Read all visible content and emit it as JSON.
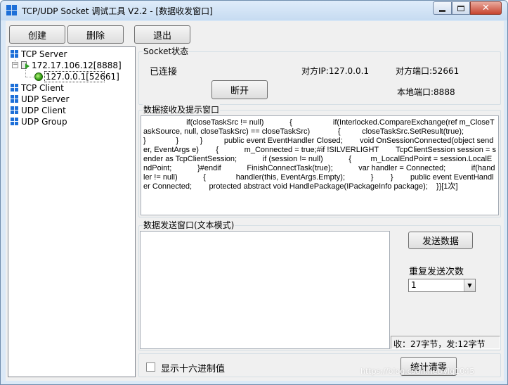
{
  "window": {
    "title": "TCP/UDP Socket 调试工具 V2.2 - [数据收发窗口]"
  },
  "toolbar": {
    "create_label": "创建",
    "delete_label": "删除",
    "exit_label": "退出"
  },
  "tree": {
    "items": [
      {
        "label": "TCP Server",
        "icon": "tcp-server-icon"
      },
      {
        "label": "172.17.106.12[8888]",
        "icon": "server-endpoint-icon",
        "expander": "⊟"
      },
      {
        "label": "127.0.0.1[52661]",
        "icon": "connected-status-icon"
      },
      {
        "label": "TCP Client",
        "icon": "tcp-client-icon"
      },
      {
        "label": "UDP Server",
        "icon": "udp-server-icon"
      },
      {
        "label": "UDP Client",
        "icon": "udp-client-icon"
      },
      {
        "label": "UDP Group",
        "icon": "udp-group-icon"
      }
    ]
  },
  "socket_status": {
    "group_title": "Socket状态",
    "state": "已连接",
    "remote_ip": "对方IP:127.0.0.1",
    "remote_port": "对方端口:52661",
    "local_port": "本地端口:8888",
    "disconnect_label": "断开"
  },
  "receive": {
    "group_title": "数据接收及提示窗口",
    "content": "                    if(closeTaskSrc != null)            {                   if(Interlocked.CompareExchange(ref m_CloseTaskSource, null, closeTaskSrc) == closeTaskSrc)             {          closeTaskSrc.SetResult(true);              }              }          }          public event EventHandler Closed;        void OnSessionConnected(object sender, EventArgs e)        {            m_Connected = true;#if !SILVERLIGHT        TcpClientSession session = sender as TcpClientSession;            if (session != null)            {         m_LocalEndPoint = session.LocalEndPoint;            }#endif            FinishConnectTask(true);            var handler = Connected;            if(handler != null)            {              handler(this, EventArgs.Empty);            }        }        public event EventHandler Connected;        protected abstract void HandlePackage(IPackageInfo package);    }}[1次]"
  },
  "send": {
    "group_title": "数据发送窗口(文本模式)",
    "text_value": "",
    "send_label": "发送数据",
    "repeat_label": "重复发送次数",
    "repeat_value": "1",
    "stats": "收：27字节，发:12字节"
  },
  "footer": {
    "hex_label": "显示十六进制值",
    "hex_checked": false,
    "clear_stats_label": "统计清零"
  },
  "watermark": "https://blog.csdn.net/ylq1045"
}
